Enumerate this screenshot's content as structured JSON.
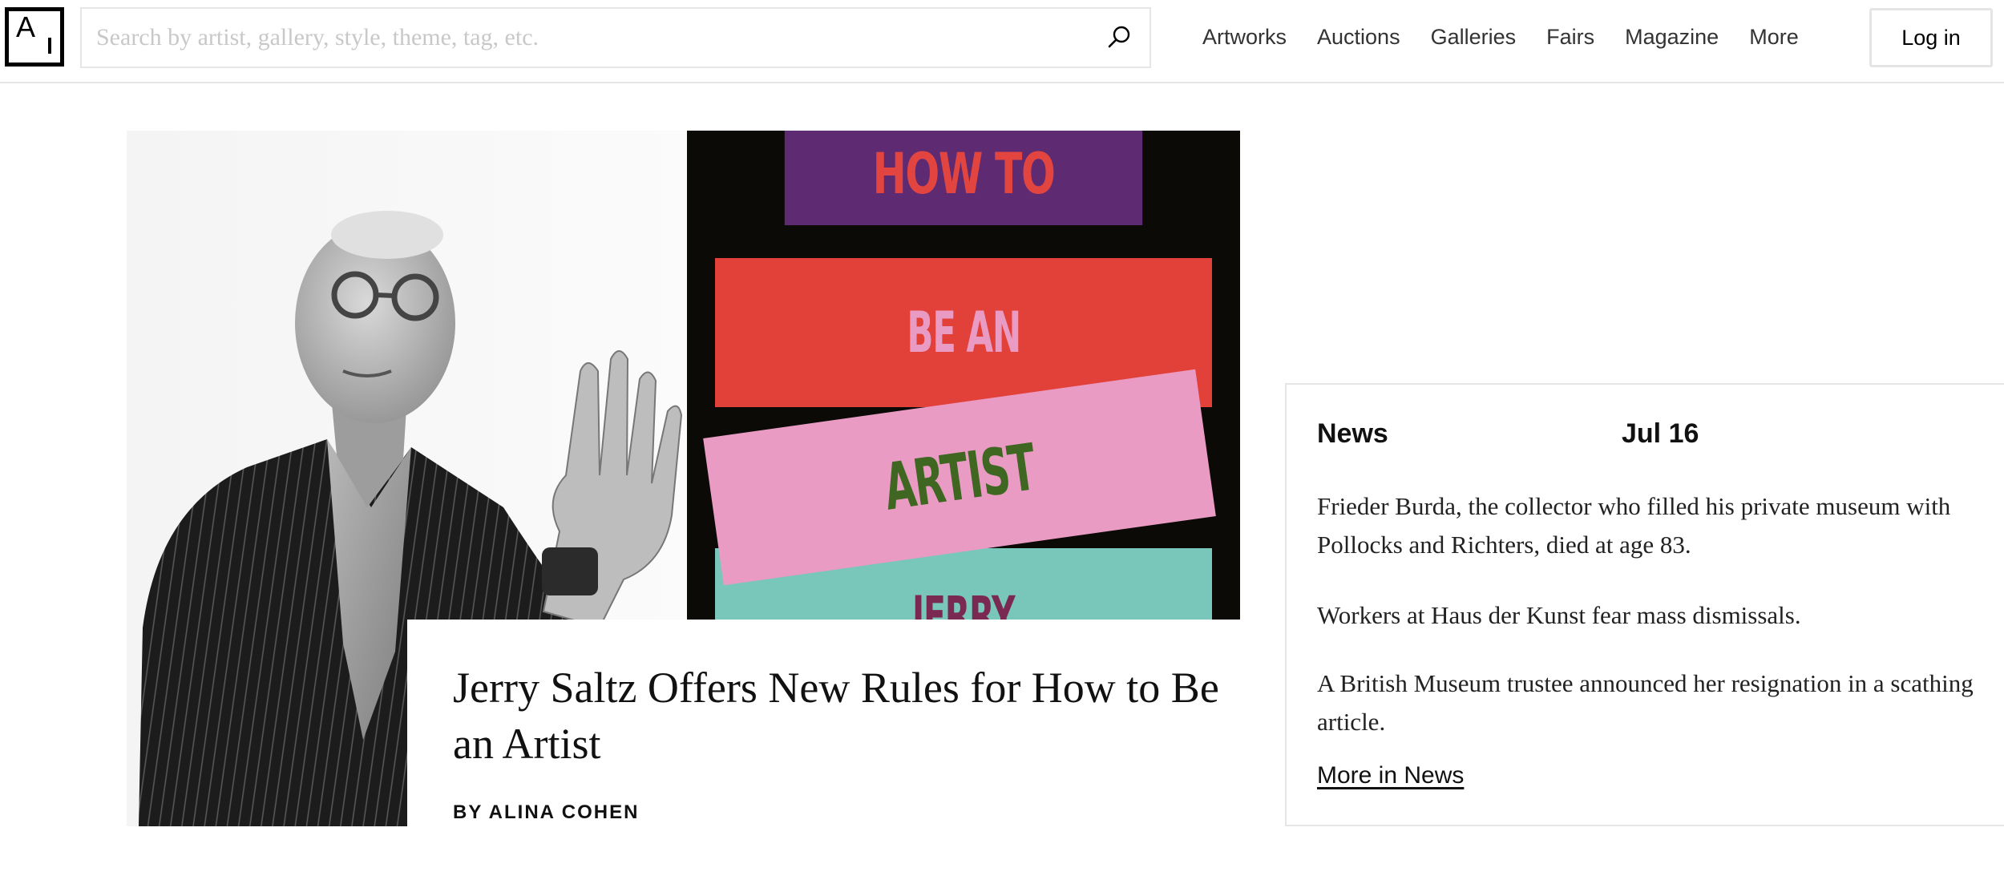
{
  "header": {
    "logo_text": "A",
    "search": {
      "placeholder": "Search by artist, gallery, style, theme, tag, etc.",
      "value": ""
    },
    "nav": [
      "Artworks",
      "Auctions",
      "Galleries",
      "Fairs",
      "Magazine",
      "More"
    ],
    "login_label": "Log in"
  },
  "hero": {
    "book_cover_lines": [
      "HOW TO",
      "BE AN",
      "ARTIST",
      "JERRY"
    ],
    "book_colors": {
      "background": "#0b0a07",
      "purple": "#5e2a72",
      "red": "#e2413a",
      "pink": "#e99bc4",
      "teal": "#79c6ba",
      "green": "#3f6722"
    },
    "headline": "Jerry Saltz Offers New Rules for How to Be an Artist",
    "byline": "BY ALINA COHEN"
  },
  "news": {
    "title": "News",
    "date": "Jul 16",
    "items": [
      "Frieder Burda, the collector who filled his private museum with Pollocks and Richters, died at age 83.",
      "Workers at Haus der Kunst fear mass dismissals.",
      "A British Museum trustee announced her resignation in a scathing article."
    ],
    "more_label": "More in News"
  }
}
